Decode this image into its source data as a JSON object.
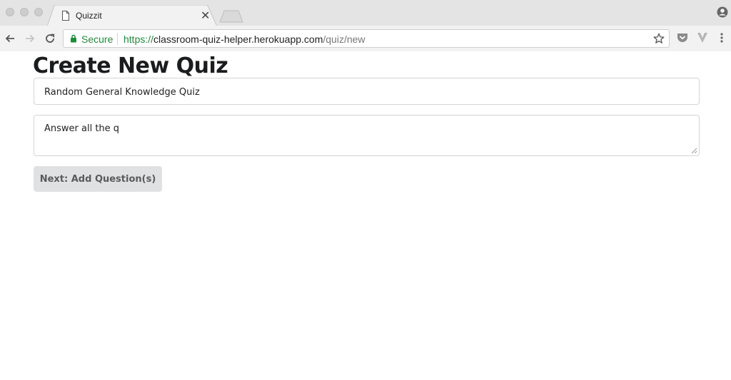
{
  "browser": {
    "tab_title": "Quizzit",
    "secure_label": "Secure",
    "url_scheme": "https://",
    "url_host": "classroom-quiz-helper.herokuapp.com",
    "url_path": "/quiz/new"
  },
  "page": {
    "heading": "Create New Quiz",
    "title_value": "Random General Knowledge Quiz",
    "description_value": "Answer all the q",
    "next_button_label": "Next: Add Question(s)"
  },
  "colors": {
    "secure_green": "#1f8a3b",
    "button_bg": "#e0e1e2"
  }
}
